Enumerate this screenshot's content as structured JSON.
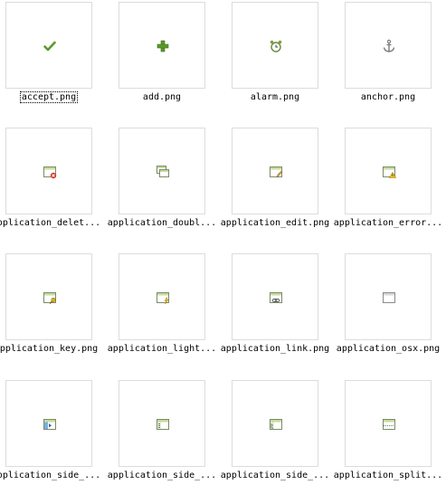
{
  "items": [
    {
      "label": "accept.png",
      "icon": "accept-icon",
      "selected": true
    },
    {
      "label": "add.png",
      "icon": "add-icon"
    },
    {
      "label": "alarm.png",
      "icon": "alarm-icon"
    },
    {
      "label": "anchor.png",
      "icon": "anchor-icon"
    },
    {
      "label": "pplication_delet...",
      "icon": "application-delete-icon"
    },
    {
      "label": "application_doubl...",
      "icon": "application-double-icon"
    },
    {
      "label": "application_edit.png",
      "icon": "application-edit-icon"
    },
    {
      "label": "application_error...",
      "icon": "application-error-icon"
    },
    {
      "label": "pplication_key.png",
      "icon": "application-key-icon"
    },
    {
      "label": "application_light...",
      "icon": "application-lightning-icon"
    },
    {
      "label": "application_link.png",
      "icon": "application-link-icon"
    },
    {
      "label": "application_osx.png",
      "icon": "application-osx-icon"
    },
    {
      "label": "pplication_side_...",
      "icon": "application-side-expand-icon"
    },
    {
      "label": "application_side_...",
      "icon": "application-side-list-icon"
    },
    {
      "label": "application_side_...",
      "icon": "application-side-tree-icon"
    },
    {
      "label": "application_split...",
      "icon": "application-split-icon"
    }
  ],
  "colors": {
    "green": "#5a9a2a",
    "window_border": "#7a8a6a",
    "title_bar": "#c8dc9c",
    "delete_red": "#d33a2a",
    "warning_yellow": "#f2c21a",
    "key_gold": "#e0b020",
    "thumb_border": "#dcdcdc"
  }
}
